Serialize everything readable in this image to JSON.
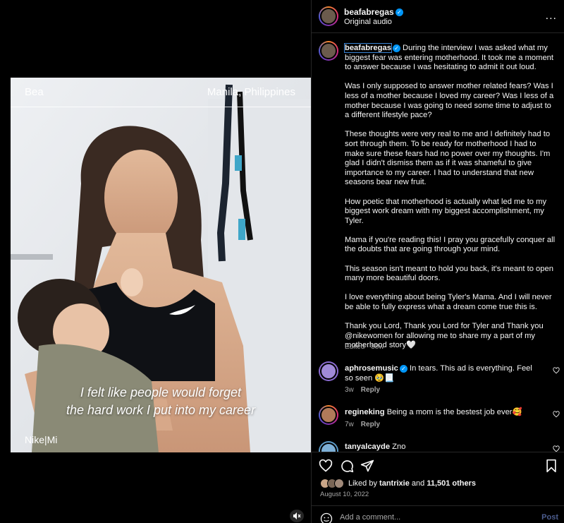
{
  "video": {
    "name_tag": "Bea",
    "location_tag": "Manila, Philippines",
    "subtitle_line1": "I felt like people would forget",
    "subtitle_line2": "the hard work I put into my career",
    "brand_watermark": "Nike|Mi"
  },
  "header": {
    "username": "beafabregas",
    "audio": "Original audio",
    "more": "..."
  },
  "caption": {
    "username": "beafabregas",
    "p1": "During the interview I was asked what my biggest fear was entering motherhood. It took me a moment to answer because I was hesitating to admit it out loud.",
    "p2": "Was I only supposed to answer mother related fears? Was I less of a mother because I loved my career? Was I less of a mother because I was going to need some time to adjust to a different lifestyle pace?",
    "p3": "These thoughts were very real to me and I definitely had to sort through them. To be ready for motherhood I had to make sure these fears had no power over my thoughts. I'm glad I didn't dismiss them as if it was shameful to give importance to my career. I had to understand that new seasons bear new fruit.",
    "p4": "How poetic that motherhood is actually what led me to my biggest work dream with my biggest accomplishment, my Tyler.",
    "p5": "Mama if you're reading this! I pray you gracefully conquer all the doubts that are going through your mind.",
    "p6": "This season isn't meant to hold you back, it's meant to open many more beautiful doors.",
    "p7": "I love everything about being Tyler's Mama. And I will never be able to fully express what a dream come true this is.",
    "p8": "Thank you Lord, Thank you Lord for Tyler and Thank you @nikewomen for allowing me to share my a part of my motherhood story🤍",
    "edited": "Edited",
    "age": "88w"
  },
  "comments": [
    {
      "user": "aphrosemusic",
      "text": "In tears. This ad is everything. Feel so seen 🥹📃",
      "age": "3w",
      "reply": "Reply"
    },
    {
      "user": "regineking",
      "text": "Being a mom is the bestest job ever🥰",
      "age": "7w",
      "reply": "Reply"
    },
    {
      "user": "tanyalcayde",
      "text": "Zno"
    }
  ],
  "likes": {
    "prefix": "Liked by",
    "user": "tantrixie",
    "and": "and",
    "count": "11,501 others"
  },
  "date": "August 10, 2022",
  "add_comment": {
    "placeholder": "Add a comment...",
    "post_label": "Post"
  },
  "colors": {
    "verified": "#0095f6",
    "secondary_text": "#a8a8a8",
    "post_disabled": "#4c5d8f"
  }
}
